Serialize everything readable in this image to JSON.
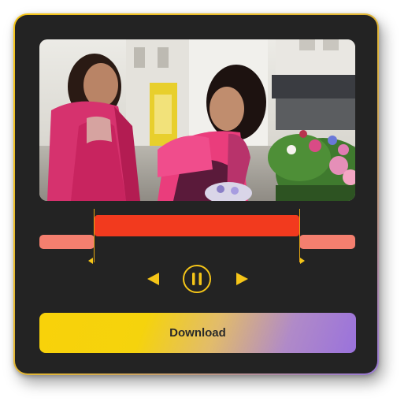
{
  "player": {
    "state": "playing",
    "accent_color": "#f5c518",
    "trim_selected_color": "#f23a1e",
    "trim_unselected_color": "#f47f6f",
    "trim_range_fraction": [
      0.17,
      0.82
    ]
  },
  "controls": {
    "prev_icon": "triangle-left-icon",
    "pause_icon": "pause-circle-icon",
    "next_icon": "triangle-right-icon"
  },
  "download": {
    "label": "Download"
  }
}
